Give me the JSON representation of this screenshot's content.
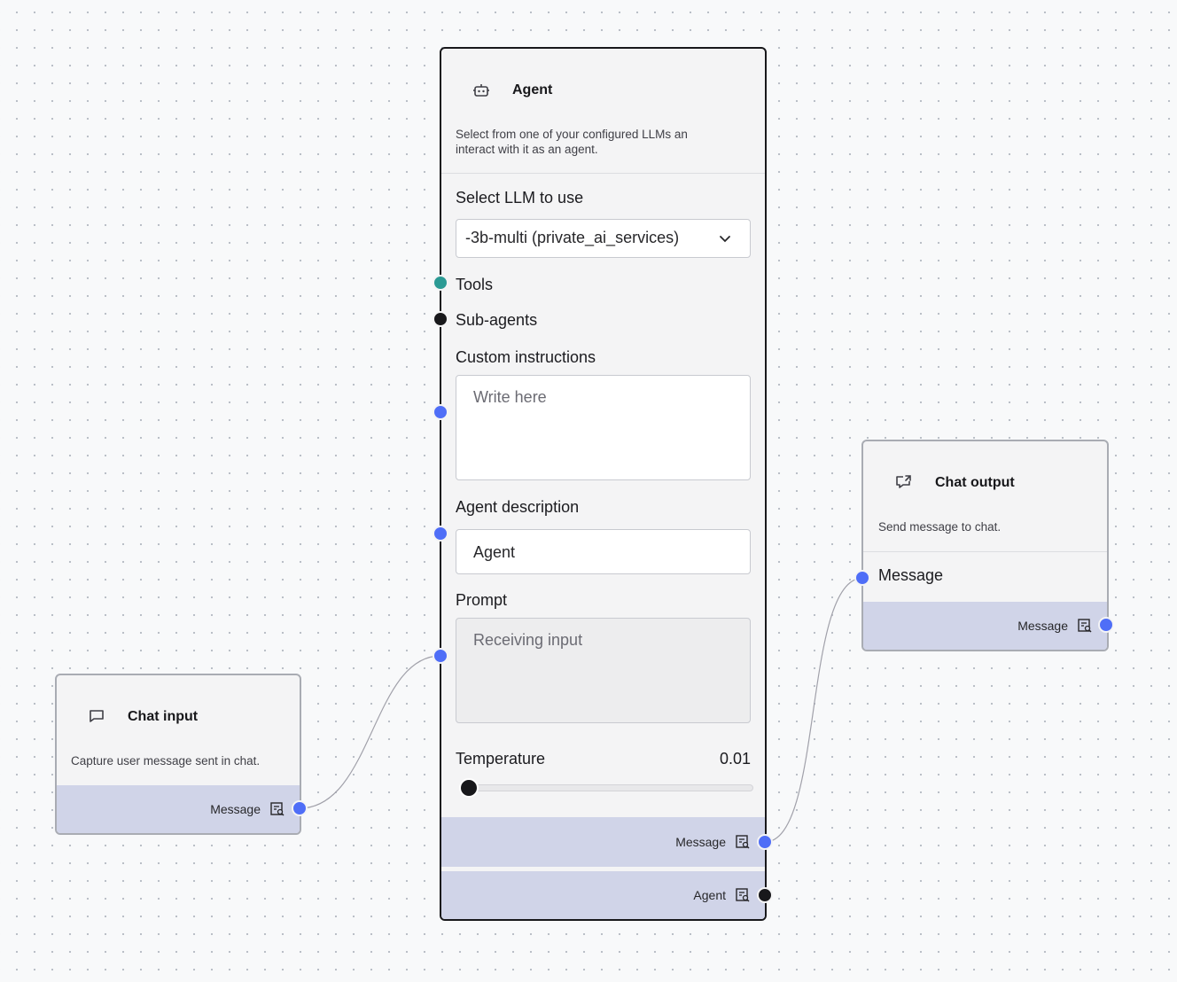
{
  "chat_input": {
    "title": "Chat input",
    "icon": "chat-bubble-icon",
    "description": "Capture user message sent in chat.",
    "output_label": "Message"
  },
  "agent": {
    "title": "Agent",
    "icon": "robot-icon",
    "description": "Select from one of your configured LLMs an interact with it as an agent.",
    "llm_label": "Select LLM to use",
    "llm_value": "-3b-multi (private_ai_services)",
    "tools_label": "Tools",
    "subagents_label": "Sub-agents",
    "instructions_label": "Custom instructions",
    "instructions_placeholder": "Write here",
    "description_label": "Agent description",
    "description_value": "Agent",
    "prompt_label": "Prompt",
    "prompt_placeholder": "Receiving input",
    "temperature_label": "Temperature",
    "temperature_value": "0.01",
    "output_message_label": "Message",
    "output_agent_label": "Agent"
  },
  "chat_output": {
    "title": "Chat output",
    "icon": "share-out-icon",
    "description": "Send message to chat.",
    "input_label": "Message",
    "output_label": "Message"
  },
  "colors": {
    "handle_message": "#4f6ef7",
    "handle_tools": "#2b9a94",
    "handle_agent": "#18181b",
    "output_bar": "#d0d4e8"
  }
}
